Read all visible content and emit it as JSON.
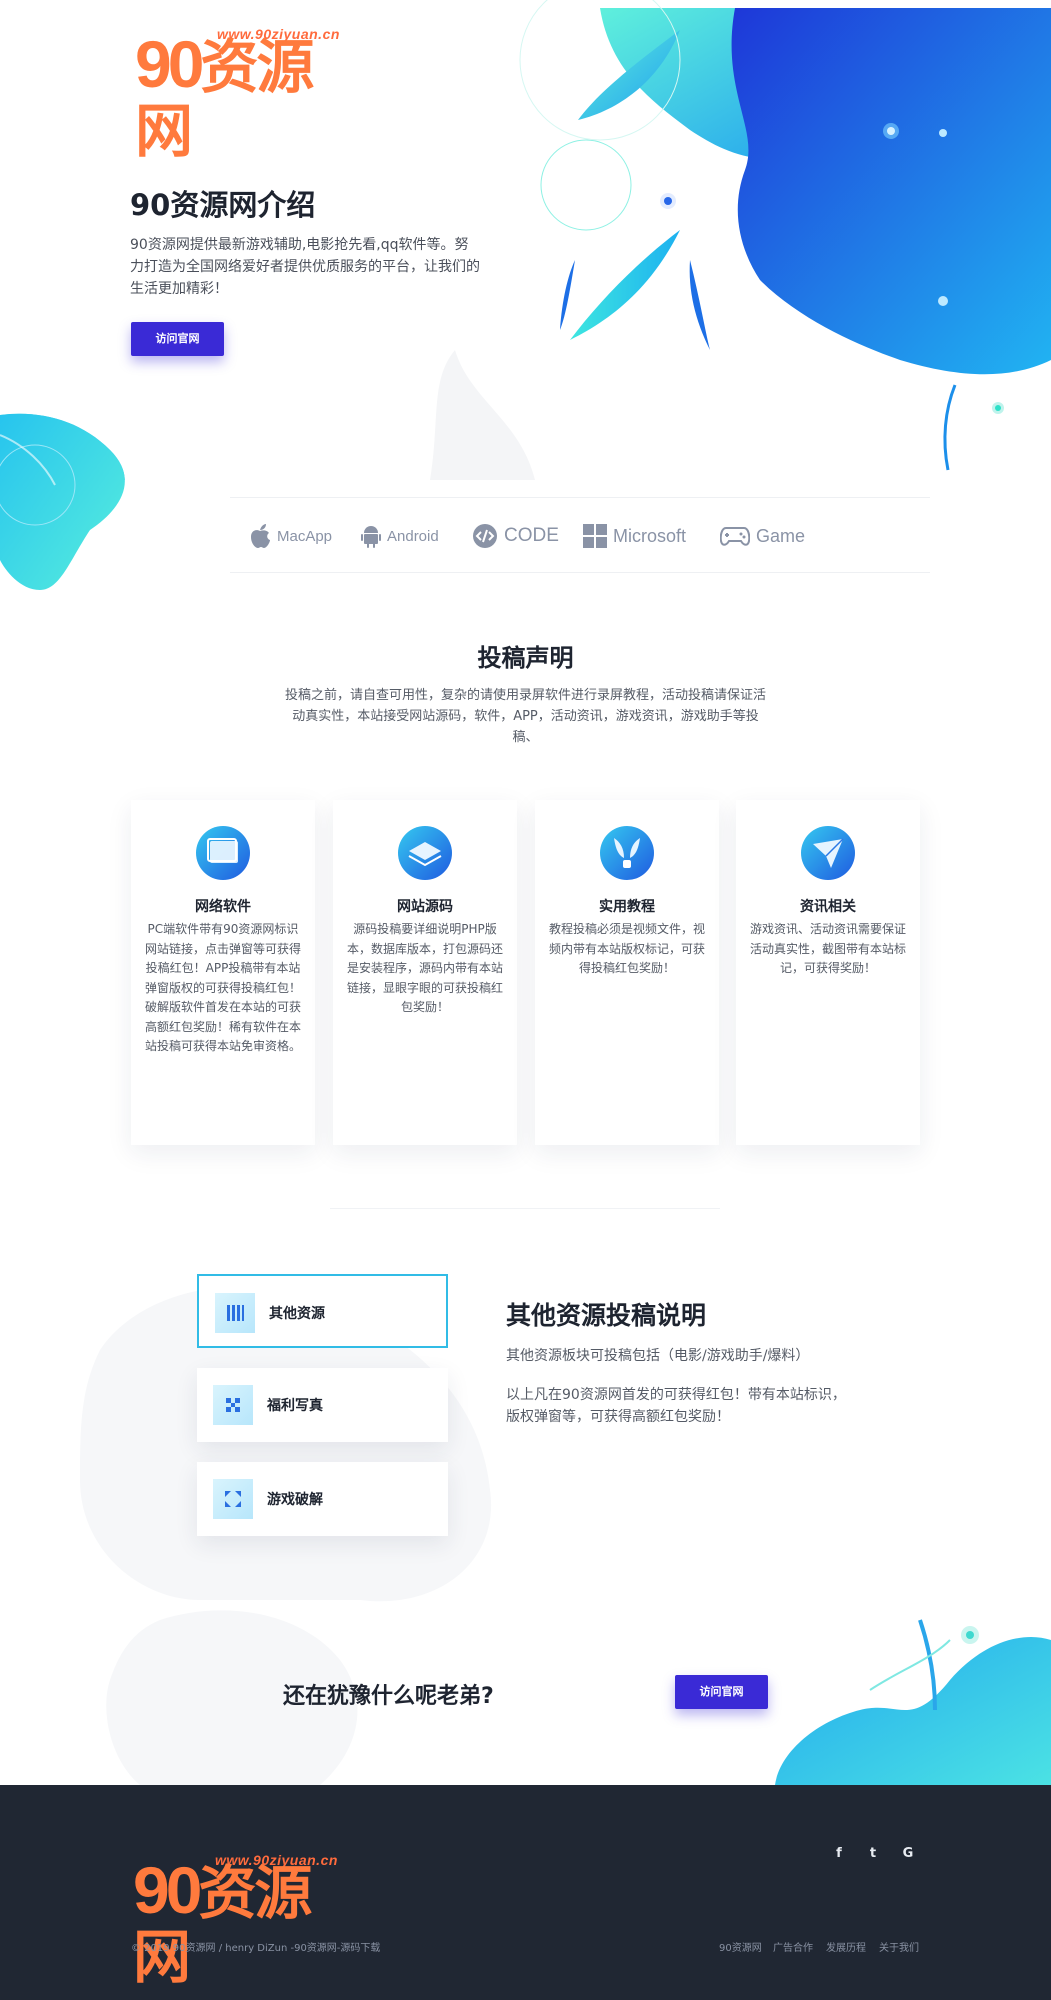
{
  "brand": {
    "logo_url": "www.90ziyuan.cn",
    "logo_num": "90",
    "logo_text": "资源网"
  },
  "hero": {
    "title": "90资源网介绍",
    "description": "90资源网提供最新游戏辅助,电影抢先看,qq软件等。努力打造为全国网络爱好者提供优质服务的平台，让我们的生活更加精彩！",
    "button": "访问官网"
  },
  "platforms": [
    {
      "label": "MacApp",
      "icon": "apple-icon"
    },
    {
      "label": "Android",
      "icon": "android-icon"
    },
    {
      "label": "CODE",
      "icon": "code-icon"
    },
    {
      "label": "Microsoft",
      "icon": "windows-icon"
    },
    {
      "label": "Game",
      "icon": "gamepad-icon"
    }
  ],
  "statement": {
    "title": "投稿声明",
    "description": "投稿之前，请自查可用性，复杂的请使用录屏软件进行录屏教程，活动投稿请保证活动真实性，本站接受网站源码，软件，APP，活动资讯，游戏资讯，游戏助手等投稿、"
  },
  "cards": [
    {
      "title": "网络软件",
      "icon": "window-icon",
      "text": "PC端软件带有90资源网标识网站链接，点击弹窗等可获得投稿红包！APP投稿带有本站弹窗版权的可获得投稿红包！破解版软件首发在本站的可获高额红包奖励！稀有软件在本站投稿可获得本站免审资格。"
    },
    {
      "title": "网站源码",
      "icon": "layers-icon",
      "text": "源码投稿要详细说明PHP版本，数据库版本，打包源码还是安装程序，源码内带有本站链接，显眼字眼的可获投稿红包奖励！"
    },
    {
      "title": "实用教程",
      "icon": "book-icon",
      "text": "教程投稿必须是视频文件，视频内带有本站版权标记，可获得投稿红包奖励！"
    },
    {
      "title": "资讯相关",
      "icon": "paper-plane-icon",
      "text": "游戏资讯、活动资讯需要保证活动真实性，截图带有本站标记，可获得奖励！"
    }
  ],
  "other": {
    "tabs": [
      {
        "label": "其他资源",
        "icon": "bars-icon"
      },
      {
        "label": "福利写真",
        "icon": "cross-icon"
      },
      {
        "label": "游戏破解",
        "icon": "expand-icon"
      }
    ],
    "title": "其他资源投稿说明",
    "p1": "其他资源板块可投稿包括（电影/游戏助手/爆料）",
    "p2": "以上凡在90资源网首发的可获得红包！带有本站标识，版权弹窗等，可获得高额红包奖励！"
  },
  "cta": {
    "text": "还在犹豫什么呢老弟?",
    "button": "访问官网"
  },
  "footer": {
    "copyright": "© 2019 90资源网 / henry DiZun -90资源网-源码下载",
    "social": [
      "f",
      "t",
      "G"
    ],
    "links": [
      "90资源网",
      "广告合作",
      "发展历程",
      "关于我们"
    ]
  },
  "colors": {
    "accent": "#3a2ad6",
    "logo": "#ff7a3d",
    "footer_bg": "#202733",
    "cyan": "#35c9f0",
    "blue": "#1f5ae0"
  }
}
